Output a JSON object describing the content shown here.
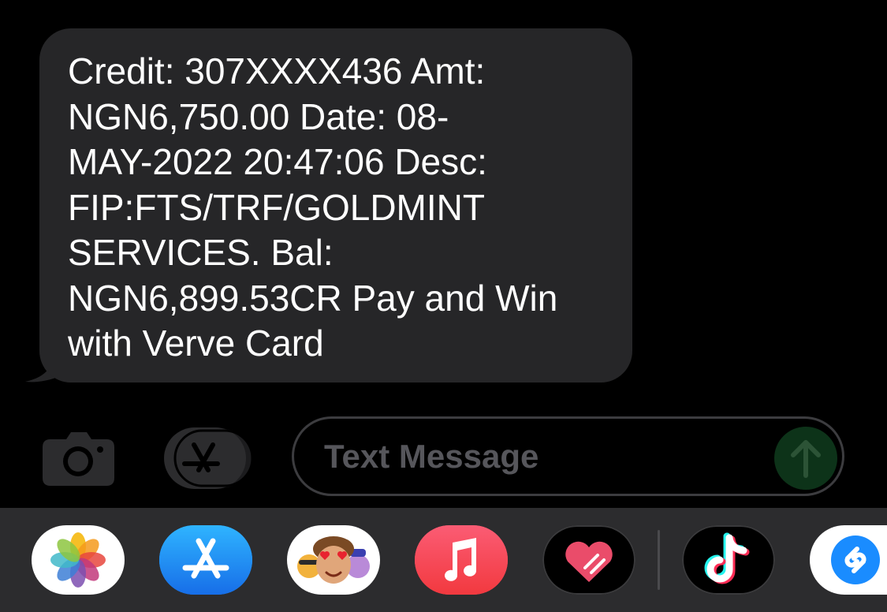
{
  "conversation": {
    "message": {
      "lines": [
        "Credit: 307XXXX436 Amt:",
        "NGN6,750.00 Date: 08-",
        "MAY-2022 20:47:06 Desc:",
        "FIP:FTS/TRF/GOLDMINT",
        "SERVICES. Bal:",
        "NGN6,899.53CR Pay and Win",
        "with Verve Card"
      ]
    }
  },
  "composer": {
    "placeholder": "Text Message",
    "value": ""
  },
  "colors": {
    "background": "#000000",
    "bubble": "#262628",
    "drawer": "#2c2c2e",
    "send_button": "#0d3319",
    "placeholder": "#56565b"
  },
  "app_drawer": {
    "apps": [
      {
        "name": "Photos",
        "icon": "photos-icon"
      },
      {
        "name": "App Store",
        "icon": "app-store-icon"
      },
      {
        "name": "Memoji",
        "icon": "memoji-icon"
      },
      {
        "name": "Music",
        "icon": "music-icon"
      },
      {
        "name": "Digital Touch",
        "icon": "digital-touch-icon"
      },
      {
        "name": "TikTok",
        "icon": "tiktok-icon"
      },
      {
        "name": "Shazam",
        "icon": "shazam-icon"
      }
    ]
  }
}
